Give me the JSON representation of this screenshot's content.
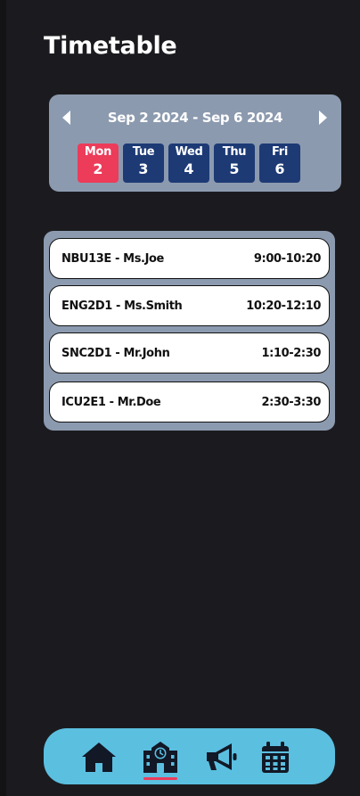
{
  "page": {
    "title": "Timetable"
  },
  "week": {
    "range": "Sep 2 2024 - Sep 6 2024",
    "days": [
      {
        "name": "Mon",
        "date": "2",
        "selected": true
      },
      {
        "name": "Tue",
        "date": "3",
        "selected": false
      },
      {
        "name": "Wed",
        "date": "4",
        "selected": false
      },
      {
        "name": "Thu",
        "date": "5",
        "selected": false
      },
      {
        "name": "Fri",
        "date": "6",
        "selected": false
      }
    ]
  },
  "classes": [
    {
      "course": "NBU13E - Ms.Joe",
      "time": "9:00-10:20"
    },
    {
      "course": "ENG2D1 - Ms.Smith",
      "time": "10:20-12:10"
    },
    {
      "course": "SNC2D1 - Mr.John",
      "time": "1:10-2:30"
    },
    {
      "course": "ICU2E1 - Mr.Doe",
      "time": "2:30-3:30"
    }
  ],
  "nav": {
    "items": [
      {
        "icon": "home-icon",
        "active": false
      },
      {
        "icon": "school-icon",
        "active": true
      },
      {
        "icon": "megaphone-icon",
        "active": false
      },
      {
        "icon": "calendar-icon",
        "active": false
      }
    ]
  },
  "colors": {
    "background": "#1b1b1f",
    "card": "#8c9aaf",
    "day_button": "#1d3a75",
    "selected_day": "#ec3c5a",
    "nav_bar": "#5bbfe0",
    "icon": "#121826"
  }
}
